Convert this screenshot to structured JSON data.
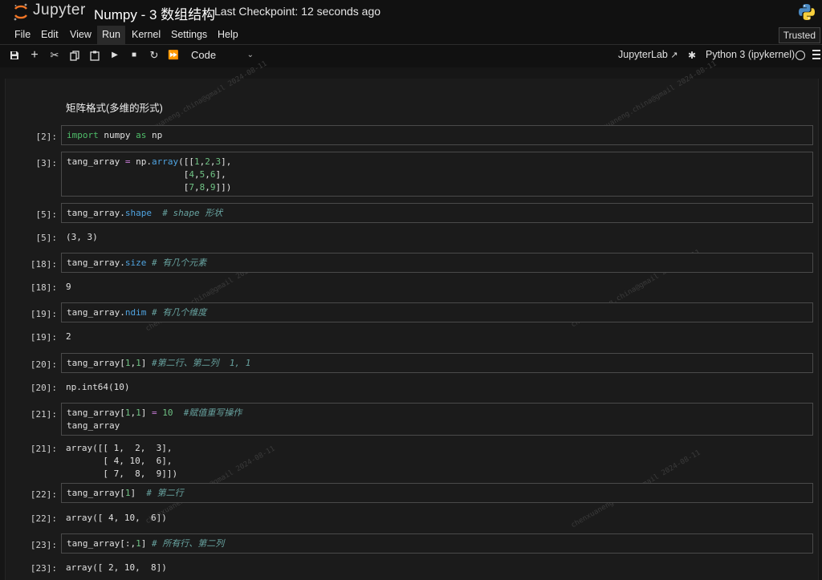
{
  "header": {
    "brand": "Jupyter",
    "title": "Numpy - 3 数组结构",
    "checkpoint": "Last Checkpoint: 12 seconds ago"
  },
  "menu": {
    "items": [
      "File",
      "Edit",
      "View",
      "Run",
      "Kernel",
      "Settings",
      "Help"
    ],
    "trusted": "Trusted"
  },
  "toolbar": {
    "cell_type": "Code",
    "jupyterlab": "JupyterLab",
    "kernel": "Python 3 (ipykernel)"
  },
  "notebook": {
    "markdown": "矩阵格式(多维的形式)",
    "cells": [
      {
        "prompt": "[2]:",
        "code": "import numpy as np"
      },
      {
        "prompt": "[3]:",
        "code": "tang_array = np.array([[1,2,3],\n                      [4,5,6],\n                      [7,8,9]])"
      },
      {
        "prompt": "[5]:",
        "code": "tang_array.shape  # shape 形状",
        "out_prompt": "[5]:",
        "output": "(3, 3)"
      },
      {
        "prompt": "[18]:",
        "code": "tang_array.size # 有几个元素",
        "out_prompt": "[18]:",
        "output": "9"
      },
      {
        "prompt": "[19]:",
        "code": "tang_array.ndim # 有几个维度",
        "out_prompt": "[19]:",
        "output": "2"
      },
      {
        "prompt": "[20]:",
        "code": "tang_array[1,1] #第二行、第二列  1, 1",
        "out_prompt": "[20]:",
        "output": "np.int64(10)"
      },
      {
        "prompt": "[21]:",
        "code": "tang_array[1,1] = 10  #赋值重写操作\ntang_array",
        "out_prompt": "[21]:",
        "output": "array([[ 1,  2,  3],\n       [ 4, 10,  6],\n       [ 7,  8,  9]])"
      },
      {
        "prompt": "[22]:",
        "code": "tang_array[1]  # 第二行",
        "out_prompt": "[22]:",
        "output": "array([ 4, 10,  6])"
      },
      {
        "prompt": "[23]:",
        "code": "tang_array[:,1] # 所有行、第二列",
        "out_prompt": "[23]:",
        "output": "array([ 2, 10,  8])"
      }
    ]
  }
}
